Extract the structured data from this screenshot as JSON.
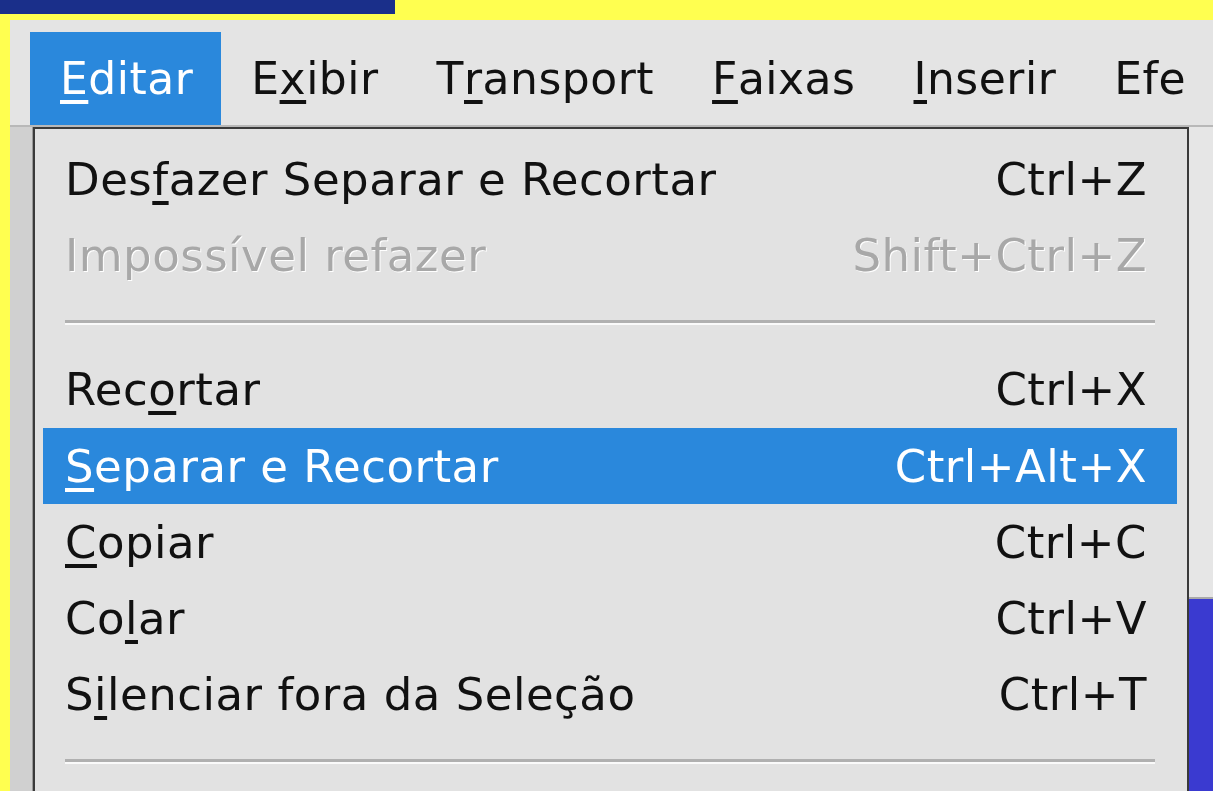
{
  "menubar": [
    {
      "key": "E",
      "after": "ditar",
      "selected": true
    },
    {
      "before": "E",
      "key": "x",
      "after": "ibir",
      "selected": false
    },
    {
      "before": "T",
      "key": "r",
      "after": "ansport",
      "selected": false
    },
    {
      "key": "F",
      "after": "aixas",
      "selected": false
    },
    {
      "key": "I",
      "after": "nserir",
      "selected": false
    },
    {
      "before": "Efe",
      "selected": false
    }
  ],
  "menu": {
    "items": [
      {
        "kind": "item",
        "before": "Des",
        "key": "f",
        "after": "azer Separar e Recortar",
        "shortcut": "Ctrl+Z",
        "disabled": false,
        "selected": false
      },
      {
        "kind": "item",
        "before": "Impossível refazer",
        "shortcut": "Shift+Ctrl+Z",
        "disabled": true,
        "selected": false
      },
      {
        "kind": "separator"
      },
      {
        "kind": "item",
        "before": "Rec",
        "key": "o",
        "after": "rtar",
        "shortcut": "Ctrl+X",
        "disabled": false,
        "selected": false
      },
      {
        "kind": "item",
        "key": "S",
        "after": "eparar e Recortar",
        "shortcut": "Ctrl+Alt+X",
        "disabled": false,
        "selected": true
      },
      {
        "kind": "item",
        "key": "C",
        "after": "opiar",
        "shortcut": "Ctrl+C",
        "disabled": false,
        "selected": false
      },
      {
        "kind": "item",
        "before": "Co",
        "key": "l",
        "after": "ar",
        "shortcut": "Ctrl+V",
        "disabled": false,
        "selected": false
      },
      {
        "kind": "item",
        "before": "S",
        "key": "i",
        "after": "lenciar fora da Seleção",
        "shortcut": "Ctrl+T",
        "disabled": false,
        "selected": false
      },
      {
        "kind": "separator"
      }
    ]
  }
}
